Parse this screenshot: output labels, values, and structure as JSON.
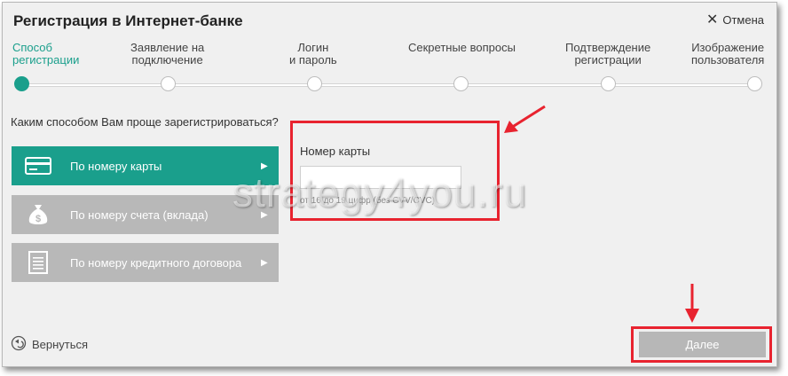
{
  "dialog": {
    "title": "Регистрация в Интернет-банке",
    "close_label": "Отмена"
  },
  "steps": [
    {
      "label": "Способ\nрегистрации",
      "active": true
    },
    {
      "label": "Заявление на\nподключение",
      "active": false
    },
    {
      "label": "Логин\nи пароль",
      "active": false
    },
    {
      "label": "Секретные вопросы",
      "active": false
    },
    {
      "label": "Подтверждение\nрегистрации",
      "active": false
    },
    {
      "label": "Изображение\nпользователя",
      "active": false
    }
  ],
  "question": "Каким способом Вам проще зарегистрироваться?",
  "methods": [
    {
      "label": "По номеру карты",
      "icon": "credit-card-icon",
      "active": true
    },
    {
      "label": "По номеру счета (вклада)",
      "icon": "money-bag-icon",
      "active": false
    },
    {
      "label": "По номеру кредитного договора",
      "icon": "document-icon",
      "active": false
    }
  ],
  "card_field": {
    "label": "Номер карты",
    "value": "",
    "hint": "от 16 до 19 цифр (без CVV/CVC)"
  },
  "watermark": "strategy4you.ru",
  "footer": {
    "back_label": "Вернуться",
    "next_label": "Далее"
  },
  "colors": {
    "accent": "#1a9f8c",
    "disabled": "#b8b8b8",
    "highlight": "#e8232f"
  }
}
